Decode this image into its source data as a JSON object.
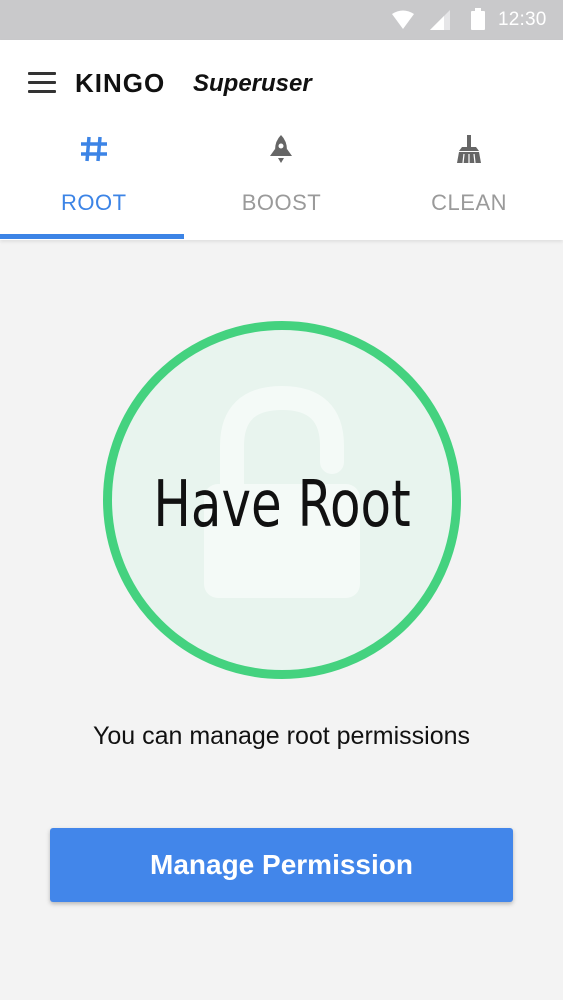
{
  "status_bar": {
    "time": "12:30",
    "icons": [
      "wifi-icon",
      "cellular-signal-icon",
      "battery-icon"
    ]
  },
  "app_bar": {
    "menu_icon": "hamburger-menu-icon",
    "brand": "KINGO",
    "brand_sub": "Superuser"
  },
  "tabs": [
    {
      "label": "ROOT",
      "icon": "hash-icon",
      "active": true
    },
    {
      "label": "BOOST",
      "icon": "rocket-icon",
      "active": false
    },
    {
      "label": "CLEAN",
      "icon": "broom-icon",
      "active": false
    }
  ],
  "main": {
    "status_title": "Have Root",
    "description": "You can manage root permissions",
    "button_label": "Manage Permission"
  },
  "colors": {
    "accent": "#3c84e6",
    "button": "#4286ea",
    "success_ring": "#44d27f",
    "inactive_tab": "#9a9a9a",
    "status_bar": "#c9c9cb"
  }
}
